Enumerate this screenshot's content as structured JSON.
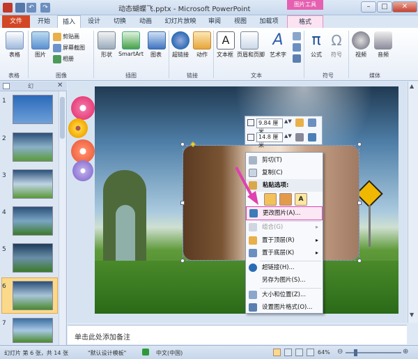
{
  "window": {
    "title": "动态蝴蝶飞.pptx - Microsoft PowerPoint",
    "context_tab": "图片工具"
  },
  "tabs": [
    "文件",
    "开始",
    "插入",
    "设计",
    "切换",
    "动画",
    "幻灯片放映",
    "审阅",
    "视图",
    "加载项",
    "格式"
  ],
  "ribbon": {
    "groups": [
      "表格",
      "图像",
      "插图",
      "链接",
      "文本",
      "符号",
      "媒体"
    ],
    "buttons": {
      "table": "表格",
      "picture": "图片",
      "clipart": "剪贴画",
      "screenshot": "屏幕截图",
      "album": "相册",
      "shapes": "形状",
      "smartart": "SmartArt",
      "chart": "图表",
      "hyperlink": "超链接",
      "action": "动作",
      "textbox": "文本框",
      "header_footer": "页眉和页脚",
      "wordart": "艺术字",
      "formula": "公式",
      "symbol": "符号",
      "video": "视频",
      "audio": "音频"
    }
  },
  "thumbnails": {
    "numbers": [
      "1",
      "2",
      "3",
      "4",
      "5",
      "6",
      "7"
    ],
    "selected": "6",
    "pane_tab": "幻"
  },
  "mini_toolbar": {
    "height": "9.84 厘米",
    "width": "14.8 厘米"
  },
  "context_menu": {
    "cut": "剪切(T)",
    "copy": "复制(C)",
    "paste_options": "粘贴选项:",
    "change_picture": "更改图片(A)...",
    "group": "组合(G)",
    "bring_front": "置于顶层(R)",
    "send_back": "置于底层(K)",
    "hyperlink": "超链接(H)...",
    "save_as_picture": "另存为图片(S)...",
    "size_position": "大小和位置(Z)...",
    "format_picture": "设置图片格式(O)..."
  },
  "notes": {
    "placeholder": "单击此处添加备注"
  },
  "status": {
    "slide_info": "幻灯片 第 6 张，共 14 张",
    "theme": "\"默认设计模板\"",
    "language": "中文(中国)",
    "zoom": "64%"
  },
  "colors": {
    "file_tab": "#d24726",
    "context_tab": "#e560b0",
    "highlight": "#e040b0"
  }
}
